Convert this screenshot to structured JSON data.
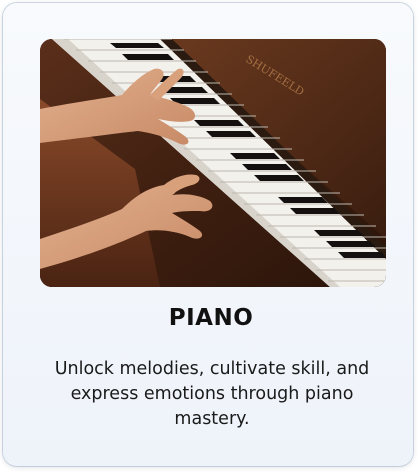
{
  "card": {
    "image_alt": "Hands playing piano keys",
    "brand_text": "SHUFEELD",
    "title": "PIANO",
    "description": "Unlock melodies, cultivate skill, and express emotions through piano mastery."
  }
}
